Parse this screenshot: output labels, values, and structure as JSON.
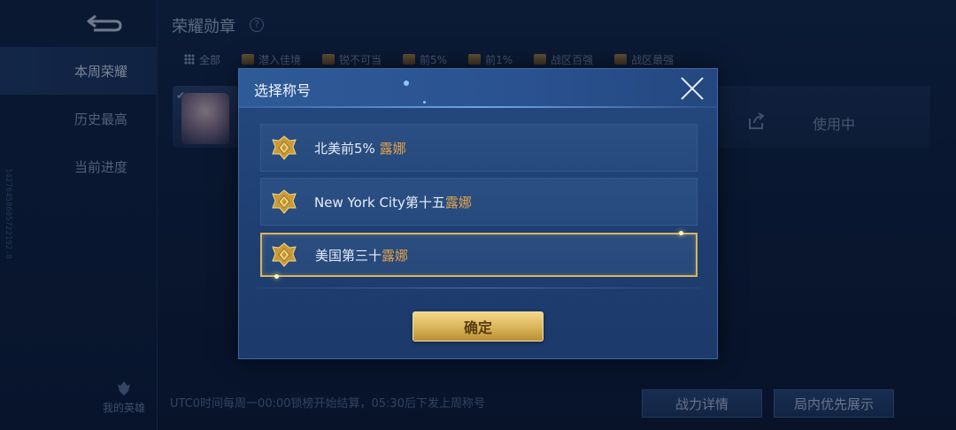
{
  "sidebar": {
    "nav": [
      {
        "label": "本周荣耀",
        "active": true
      },
      {
        "label": "历史最高",
        "active": false
      },
      {
        "label": "当前进度",
        "active": false
      }
    ],
    "device_id": "14276458605722192.8",
    "my_hero_label": "我的英雄"
  },
  "header": {
    "title": "荣耀勋章",
    "help_glyph": "?"
  },
  "filters": [
    {
      "label": "全部",
      "icon": "grid-icon"
    },
    {
      "label": "潜入佳境",
      "icon": "badge-icon"
    },
    {
      "label": "锐不可当",
      "icon": "badge-icon"
    },
    {
      "label": "前5%",
      "icon": "badge-icon"
    },
    {
      "label": "前1%",
      "icon": "badge-icon"
    },
    {
      "label": "战区百强",
      "icon": "badge-icon"
    },
    {
      "label": "战区最强",
      "icon": "badge-icon"
    }
  ],
  "hero_row": {
    "status": "使用中"
  },
  "footer": {
    "note": "UTC0时间每周一00:00锁榜开始结算，05:30后下发上周称号",
    "buttons": [
      "战力详情",
      "局内优先展示"
    ]
  },
  "modal": {
    "title": "选择称号",
    "options": [
      {
        "prefix": "北美前5% ",
        "hero": "露娜",
        "selected": false
      },
      {
        "prefix": "New York City第十五",
        "hero": "露娜",
        "selected": false
      },
      {
        "prefix": "美国第三十",
        "hero": "露娜",
        "selected": true
      }
    ],
    "confirm_label": "确定"
  },
  "colors": {
    "gold_accent": "#d9b45c",
    "hero_name": "#e3a24a",
    "panel_blue": "#25497f"
  }
}
